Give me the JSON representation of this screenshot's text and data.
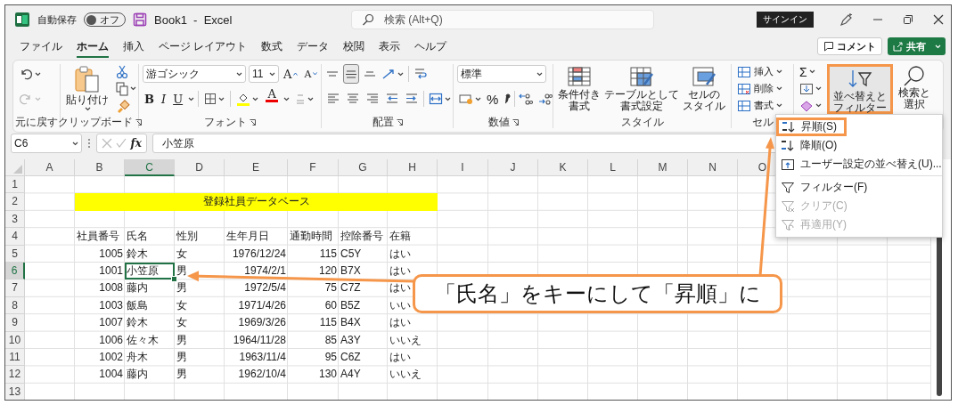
{
  "title_bar": {
    "autosave_label": "自動保存",
    "autosave": {
      "label": "オフ",
      "on": false
    },
    "document_title": "Book1  -  Excel",
    "search": {
      "placeholder": "検索 (Alt+Q)"
    },
    "signin": "サインイン"
  },
  "menu": {
    "tabs": [
      {
        "label": "ファイル",
        "selected": false
      },
      {
        "label": "ホーム",
        "selected": true
      },
      {
        "label": "挿入",
        "selected": false
      },
      {
        "label": "ページ レイアウト",
        "selected": false
      },
      {
        "label": "数式",
        "selected": false
      },
      {
        "label": "データ",
        "selected": false
      },
      {
        "label": "校閲",
        "selected": false
      },
      {
        "label": "表示",
        "selected": false
      },
      {
        "label": "ヘルプ",
        "selected": false
      }
    ],
    "comment_button": "コメント",
    "share_button": "共有"
  },
  "ribbon": {
    "groups": [
      {
        "kind": "undo",
        "label": "元に戻す",
        "redo_disabled": true
      },
      {
        "kind": "clipboard",
        "label": "クリップボード",
        "paste": "貼り付け"
      },
      {
        "kind": "font",
        "label": "フォント",
        "font_name": "游ゴシック",
        "font_size": "11",
        "grow": "A",
        "shrink": "A",
        "styles": [
          "B",
          "I",
          "U"
        ],
        "font_color": "A"
      },
      {
        "kind": "alignment",
        "label": "配置",
        "vertical_buttons": [
          {
            "kind": "top",
            "selected": false
          },
          {
            "kind": "middle",
            "selected": true
          },
          {
            "kind": "bottom",
            "selected": false
          }
        ]
      },
      {
        "kind": "number",
        "label": "数値",
        "format": "標準",
        "percent": "%"
      },
      {
        "kind": "styles",
        "label": "スタイル",
        "buttons": [
          {
            "kind": "conditional",
            "lines": [
              "条件付き",
              "書式"
            ]
          },
          {
            "kind": "table",
            "lines": [
              "テーブルとして",
              "書式設定"
            ]
          },
          {
            "kind": "cell",
            "lines": [
              "セルの",
              "スタイル"
            ]
          }
        ]
      },
      {
        "kind": "cells",
        "label": "セル",
        "buttons": [
          {
            "kind": "insert",
            "label": "挿入"
          },
          {
            "kind": "delete",
            "label": "削除"
          },
          {
            "kind": "format",
            "label": "書式"
          }
        ]
      },
      {
        "kind": "editing",
        "sum": "Σ",
        "sort": {
          "lines": [
            "並べ替えと",
            "フィルター"
          ],
          "highlighted": true
        },
        "find": {
          "lines": [
            "検索と",
            "選択"
          ]
        }
      }
    ]
  },
  "formula_bar": {
    "name_box": "C6",
    "function_button": "fx",
    "formula": "小笠原"
  },
  "sheet": {
    "columns": [
      {
        "letter": "A",
        "selected": false
      },
      {
        "letter": "B",
        "selected": false,
        "numeric": true
      },
      {
        "letter": "C",
        "selected": true,
        "numeric": false
      },
      {
        "letter": "D",
        "selected": false,
        "numeric": false
      },
      {
        "letter": "E",
        "selected": false,
        "numeric": true
      },
      {
        "letter": "F",
        "selected": false,
        "numeric": true
      },
      {
        "letter": "G",
        "selected": false,
        "numeric": false
      },
      {
        "letter": "H",
        "selected": false,
        "numeric": false
      },
      {
        "letter": "I",
        "selected": false
      },
      {
        "letter": "J",
        "selected": false
      },
      {
        "letter": "K",
        "selected": false
      },
      {
        "letter": "L",
        "selected": false
      },
      {
        "letter": "M",
        "selected": false
      },
      {
        "letter": "N",
        "selected": false
      },
      {
        "letter": "O",
        "selected": false
      }
    ],
    "rows": [
      {
        "number": "1",
        "kind": "empty",
        "selected": false
      },
      {
        "number": "2",
        "kind": "banner",
        "selected": false,
        "text": "登録社員データベース"
      },
      {
        "number": "3",
        "kind": "empty",
        "selected": false
      },
      {
        "number": "4",
        "kind": "header",
        "selected": false,
        "cells": [
          "社員番号",
          "氏名",
          "性別",
          "生年月日",
          "通勤時間",
          "控除番号",
          "在籍"
        ]
      },
      {
        "number": "5",
        "kind": "record",
        "selected": false,
        "cells": [
          "1005",
          "鈴木",
          "女",
          "1976/12/24",
          "115",
          "C5Y",
          "はい"
        ]
      },
      {
        "number": "6",
        "kind": "record",
        "selected": true,
        "cells": [
          "1001",
          "小笠原",
          "男",
          "1974/2/1",
          "120",
          "B7X",
          "はい"
        ]
      },
      {
        "number": "7",
        "kind": "record",
        "selected": false,
        "cells": [
          "1008",
          "藤内",
          "男",
          "1972/5/4",
          "75",
          "C7Z",
          "はい"
        ]
      },
      {
        "number": "8",
        "kind": "record",
        "selected": false,
        "cells": [
          "1003",
          "飯島",
          "女",
          "1971/4/26",
          "60",
          "B5Z",
          "いい"
        ]
      },
      {
        "number": "9",
        "kind": "record",
        "selected": false,
        "cells": [
          "1007",
          "鈴木",
          "女",
          "1969/3/26",
          "115",
          "B4X",
          "はい"
        ]
      },
      {
        "number": "10",
        "kind": "record",
        "selected": false,
        "cells": [
          "1006",
          "佐々木",
          "男",
          "1964/11/28",
          "85",
          "A3Y",
          "いいえ"
        ]
      },
      {
        "number": "11",
        "kind": "record",
        "selected": false,
        "cells": [
          "1002",
          "舟木",
          "男",
          "1963/11/4",
          "95",
          "C6Z",
          "はい"
        ]
      },
      {
        "number": "12",
        "kind": "record",
        "selected": false,
        "cells": [
          "1004",
          "藤内",
          "男",
          "1962/10/4",
          "130",
          "A4Y",
          "いいえ"
        ]
      },
      {
        "number": "13",
        "kind": "empty",
        "selected": false
      }
    ]
  },
  "sort_menu": {
    "sections": [
      [
        {
          "kind": "asc",
          "label": "昇順(S)",
          "disabled": false,
          "highlighted": true
        },
        {
          "kind": "desc",
          "label": "降順(O)",
          "disabled": false,
          "highlighted": false
        },
        {
          "kind": "custom",
          "label": "ユーザー設定の並べ替え(U)...",
          "disabled": false,
          "highlighted": false
        }
      ],
      [
        {
          "kind": "filter",
          "label": "フィルター(F)",
          "disabled": false,
          "highlighted": false
        },
        {
          "kind": "clear",
          "label": "クリア(C)",
          "disabled": true,
          "highlighted": false
        },
        {
          "kind": "reapply",
          "label": "再適用(Y)",
          "disabled": true,
          "highlighted": false
        }
      ]
    ]
  },
  "annotation": {
    "text": "「氏名」をキーにして「昇順」に"
  }
}
